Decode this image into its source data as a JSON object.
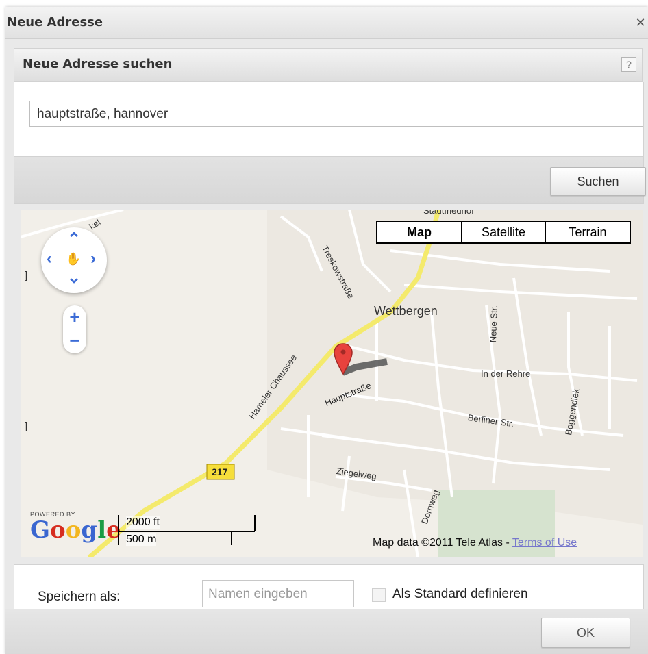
{
  "dialog": {
    "title": "Neue Adresse",
    "close_icon": "close-icon"
  },
  "search_section": {
    "title": "Neue Adresse suchen",
    "help_label": "?",
    "query_value": "hauptstraße, hannover",
    "search_button": "Suchen"
  },
  "map": {
    "type_buttons": [
      "Map",
      "Satellite",
      "Terrain"
    ],
    "active_type": "Map",
    "labels": {
      "town": "Wettbergen",
      "road_hameln": "Hameler Chaussee",
      "road_treskow": "Treskowstraße",
      "road_haupt": "Hauptstraße",
      "road_neue": "Neue Str.",
      "road_rehre": "In der Rehre",
      "road_berliner": "Berliner Str.",
      "road_boggendiek": "Boggendiek",
      "road_ziegel": "Ziegelweg",
      "road_dornweg": "Dornweg",
      "road_number": "217",
      "top_partial": "Stadtfriedhof",
      "top_left_partial": "kel",
      "side_left": "]",
      "side_left2": "]"
    },
    "powered_by": "POWERED BY",
    "google_letters": [
      "G",
      "o",
      "o",
      "g",
      "l",
      "e"
    ],
    "google_colors": [
      "#3a66d0",
      "#d62d20",
      "#f3b61f",
      "#3a66d0",
      "#1a9c45",
      "#d62d20"
    ],
    "scale_ft": "2000 ft",
    "scale_m": "500 m",
    "copyright": "Map data ©2011 Tele Atlas - ",
    "terms": "Terms of Use",
    "marker_color": "#e8423d",
    "route_color": "#f4ea6c"
  },
  "footer": {
    "save_label": "Speichern als:",
    "name_placeholder": "Namen eingeben",
    "default_label": "Als Standard definieren",
    "ok_button": "OK"
  }
}
